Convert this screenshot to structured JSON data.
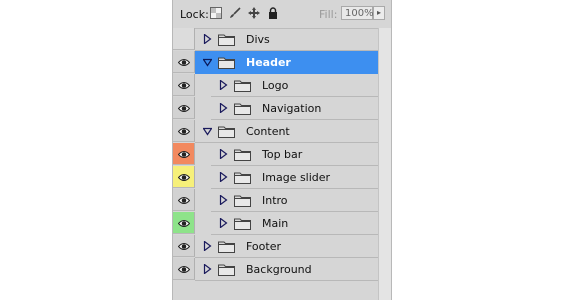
{
  "toolbar": {
    "lock_label": "Lock:",
    "fill_label": "Fill:",
    "fill_value": "100%",
    "icons": [
      "transparency-lock-icon",
      "brush-lock-icon",
      "move-lock-icon",
      "padlock-icon",
      "dropdown-arrow-icon"
    ]
  },
  "colors": {
    "selected_bg": "#3d8ff0",
    "red_tag": "#f2895f",
    "yellow_tag": "#f6f07a",
    "green_tag": "#8ee38a"
  },
  "layers": [
    {
      "name": "Divs",
      "level": 0,
      "expanded": false,
      "visible": false,
      "selected": false,
      "tag": "none"
    },
    {
      "name": "Header",
      "level": 0,
      "expanded": true,
      "visible": true,
      "selected": true,
      "tag": "none"
    },
    {
      "name": "Logo",
      "level": 1,
      "expanded": false,
      "visible": true,
      "selected": false,
      "tag": "none"
    },
    {
      "name": "Navigation",
      "level": 1,
      "expanded": false,
      "visible": true,
      "selected": false,
      "tag": "none"
    },
    {
      "name": "Content",
      "level": 0,
      "expanded": true,
      "visible": true,
      "selected": false,
      "tag": "none"
    },
    {
      "name": "Top bar",
      "level": 1,
      "expanded": false,
      "visible": true,
      "selected": false,
      "tag": "red"
    },
    {
      "name": "Image slider",
      "level": 1,
      "expanded": false,
      "visible": true,
      "selected": false,
      "tag": "yellow"
    },
    {
      "name": "Intro",
      "level": 1,
      "expanded": false,
      "visible": true,
      "selected": false,
      "tag": "none"
    },
    {
      "name": "Main",
      "level": 1,
      "expanded": false,
      "visible": true,
      "selected": false,
      "tag": "green"
    },
    {
      "name": "Footer",
      "level": 0,
      "expanded": false,
      "visible": true,
      "selected": false,
      "tag": "none"
    },
    {
      "name": "Background",
      "level": 0,
      "expanded": false,
      "visible": true,
      "selected": false,
      "tag": "none"
    }
  ]
}
